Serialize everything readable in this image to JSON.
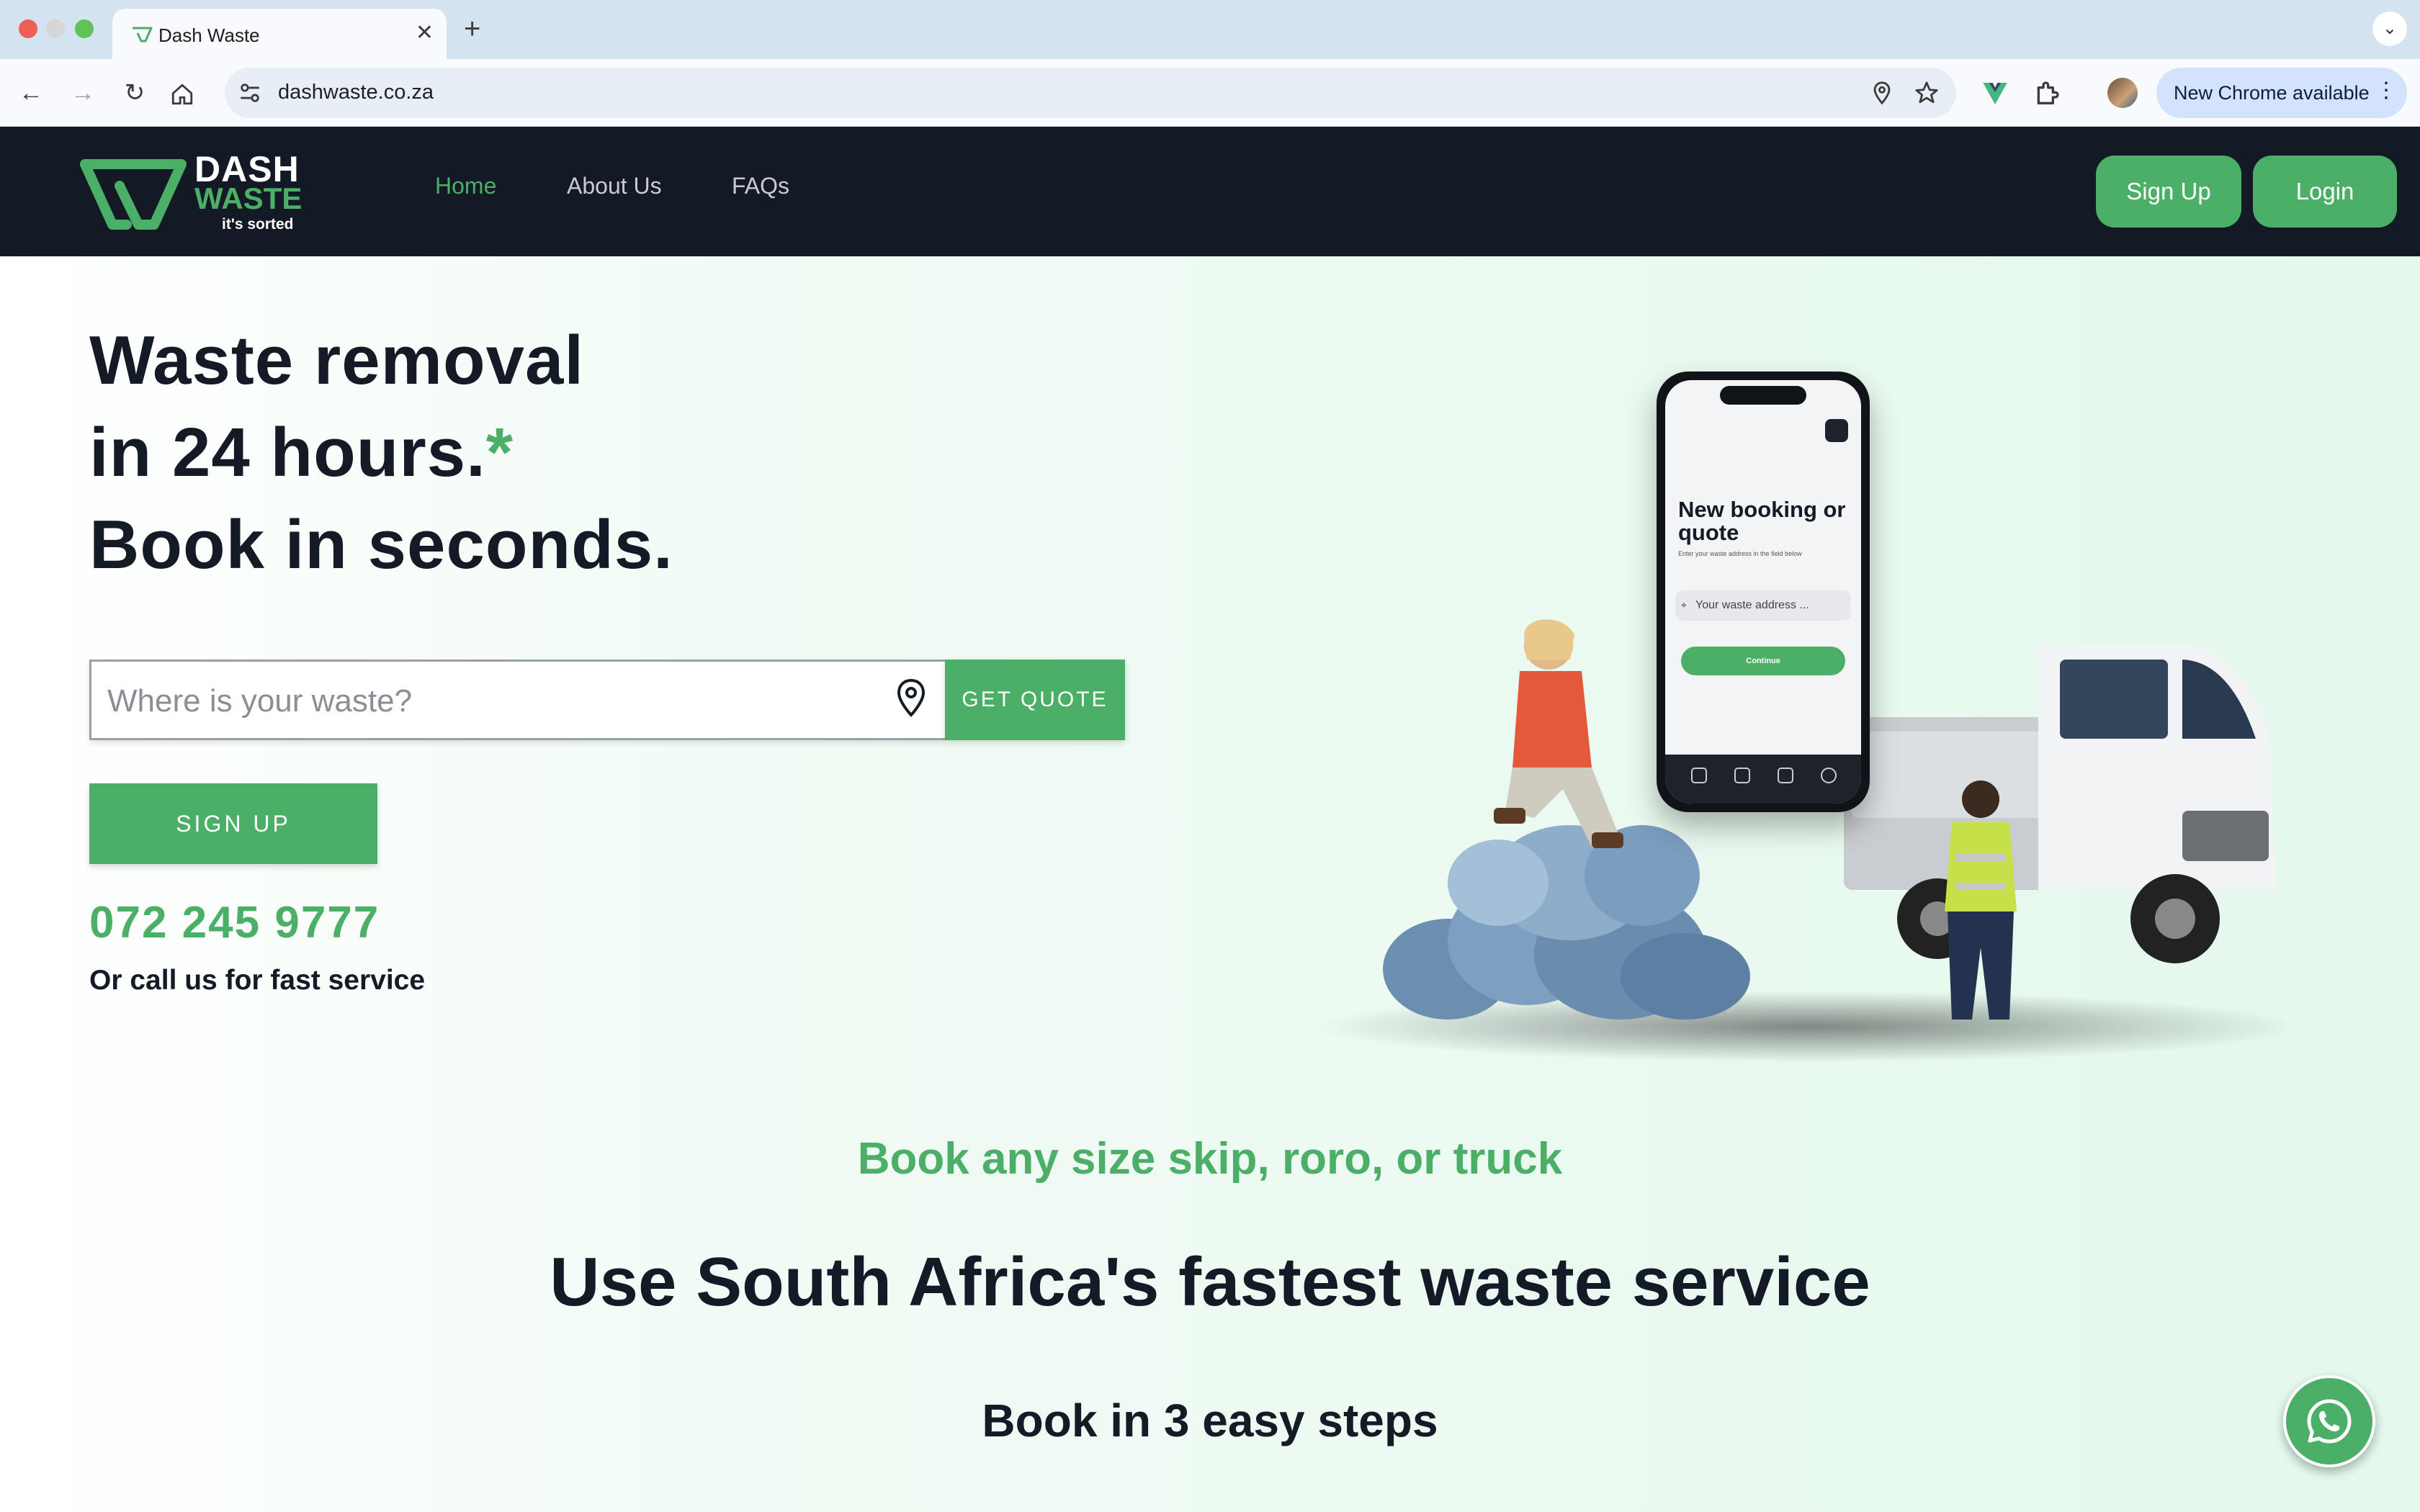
{
  "browser": {
    "tab_title": "Dash Waste",
    "url": "dashwaste.co.za",
    "update_label": "New Chrome available"
  },
  "header": {
    "logo_line1": "DASH",
    "logo_line2": "WASTE",
    "logo_tagline": "it's sorted",
    "nav": [
      "Home",
      "About Us",
      "FAQs"
    ],
    "active_nav": "Home",
    "signup_label": "Sign Up",
    "login_label": "Login"
  },
  "hero": {
    "line1": "Waste removal",
    "line2": "in 24 hours.",
    "asterisk": "*",
    "line3": "Book in seconds.",
    "search_placeholder": "Where is your waste?",
    "quote_button": "GET QUOTE",
    "signup_button": "SIGN UP",
    "phone_number": "072 245 9777",
    "call_text": "Or call us for fast service"
  },
  "phone_mockup": {
    "title": "New booking or quote",
    "subtitle": "Enter your waste address in the field below",
    "field_label": "Your waste address ...",
    "continue_label": "Continue"
  },
  "section": {
    "subheading": "Book any size skip, roro, or truck",
    "heading": "Use South Africa's fastest waste service",
    "steps_heading": "Book in 3 easy steps"
  },
  "colors": {
    "brand_green": "#4caf68",
    "header_dark": "#141a25",
    "text_dark": "#151b26"
  }
}
